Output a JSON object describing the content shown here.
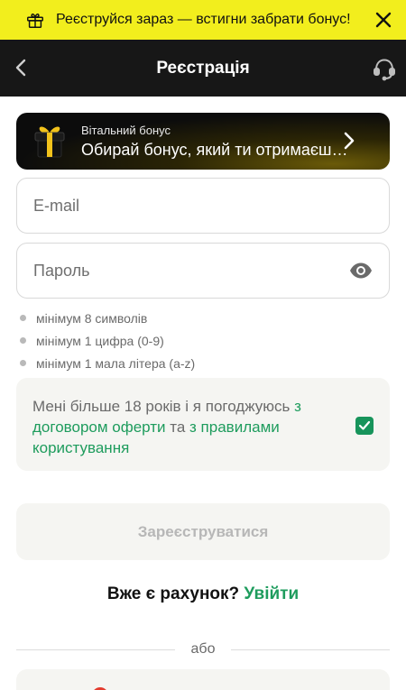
{
  "promo": {
    "text": "Реєструйся зараз — встигни забрати бонус!"
  },
  "header": {
    "title": "Реєстрація"
  },
  "bonus": {
    "subtitle": "Вітальний бонус",
    "title": "Обирай бонус, який ти отримаєш пі..."
  },
  "form": {
    "email_placeholder": "E-mail",
    "password_placeholder": "Пароль",
    "rules": [
      "мінімум 8 символів",
      "мінімум 1 цифра (0-9)",
      "мінімум 1 мала літера (a-z)"
    ],
    "agree_prefix": "Мені більше 18 років і я погоджуюсь ",
    "agree_link1": "з договором оферти",
    "agree_mid": " та ",
    "agree_link2": "з правилами користування",
    "checkbox_checked": true,
    "submit_label": "Зареєструватися"
  },
  "login": {
    "question": "Вже є рахунок?",
    "link": "Увійти"
  },
  "divider": {
    "text": "або"
  },
  "colors": {
    "promo_bg": "#f2ee1d",
    "header_bg": "#171717",
    "accent_green": "#1e9c5d"
  }
}
